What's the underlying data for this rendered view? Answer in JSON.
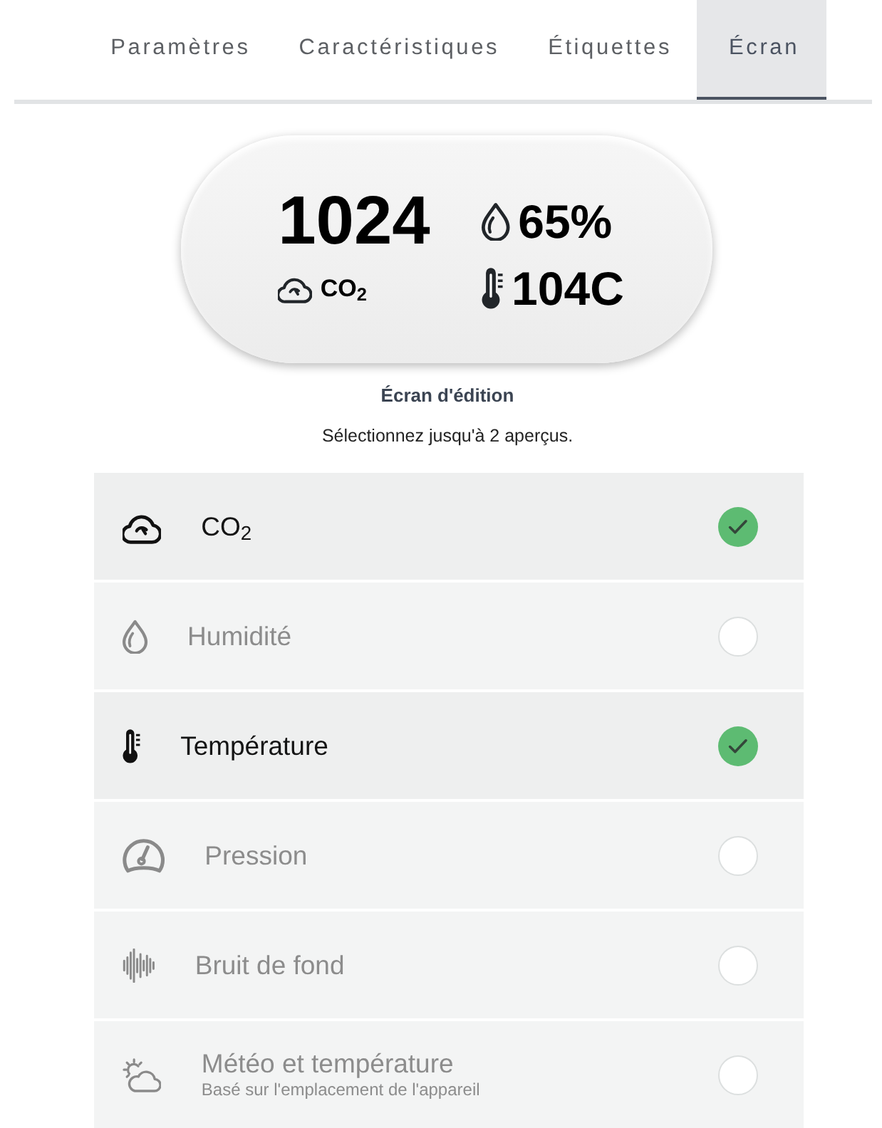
{
  "tabs": [
    {
      "label": "Paramètres",
      "selected": false
    },
    {
      "label": "Caractéristiques",
      "selected": false
    },
    {
      "label": "Étiquettes",
      "selected": false
    },
    {
      "label": "Écran",
      "selected": true
    }
  ],
  "preview": {
    "main": {
      "value": "1024",
      "unit": "CO$_{2}$"
    },
    "side": [
      {
        "kind": "humidity",
        "value": "65%"
      },
      {
        "kind": "temperature",
        "value": "104C"
      }
    ]
  },
  "editor": {
    "title": "Écran d'édition",
    "hint": "Sélectionnez jusqu'à 2 aperçus."
  },
  "items": [
    {
      "kind": "co2",
      "label": "CO$_{2}$",
      "selected": true
    },
    {
      "kind": "humidity",
      "label": "Humidité",
      "selected": false
    },
    {
      "kind": "temperature",
      "label": "Température",
      "selected": true
    },
    {
      "kind": "pressure",
      "label": "Pression",
      "selected": false
    },
    {
      "kind": "noise",
      "label": "Bruit de fond",
      "selected": false
    },
    {
      "kind": "weather",
      "label": "Météo et température",
      "subtitle": "Basé sur l'emplacement de l'appareil",
      "selected": false
    }
  ]
}
